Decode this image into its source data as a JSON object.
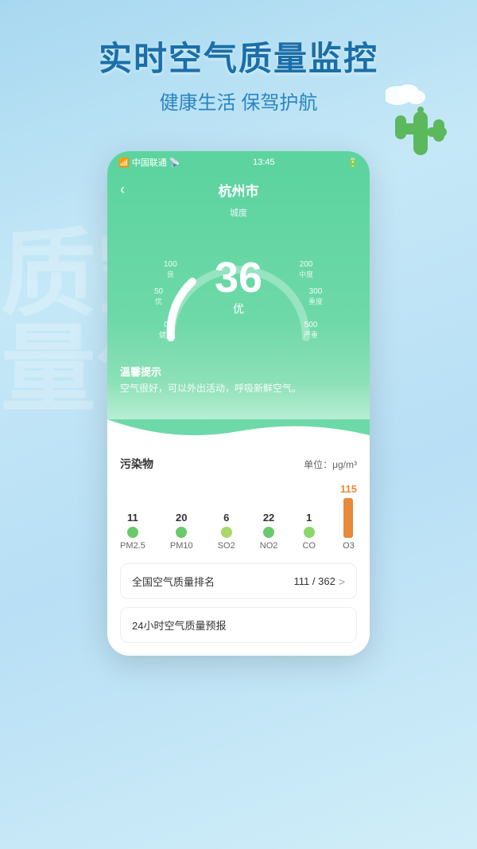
{
  "page": {
    "background": "#a8d8f0",
    "watermark": "空气质量"
  },
  "header": {
    "main_title": "实时空气质量监控",
    "sub_title": "健康生活 保驾护航"
  },
  "status_bar": {
    "carrier": "中国联通",
    "signal": "📶",
    "time": "13:45",
    "battery": "🔋"
  },
  "city_header": {
    "back_label": "‹",
    "city_name": "杭州市",
    "quality_label": "城度"
  },
  "gauge": {
    "aqi_value": "36",
    "quality": "优",
    "labels": [
      {
        "value": "100",
        "sub": "良",
        "angle": "left-upper"
      },
      {
        "value": "200",
        "sub": "中度",
        "angle": "right-upper"
      },
      {
        "value": "50",
        "sub": "优",
        "angle": "left-mid"
      },
      {
        "value": "300",
        "sub": "重度",
        "angle": "right-mid"
      },
      {
        "value": "0",
        "sub": "健康",
        "angle": "left-lower"
      },
      {
        "value": "500",
        "sub": "严重",
        "angle": "right-lower"
      }
    ]
  },
  "tip": {
    "title": "温馨提示",
    "text": "空气很好，可以外出活动，呼吸新鲜空气。"
  },
  "pollutants": {
    "title": "污染物",
    "unit": "单位：μg/m³",
    "items": [
      {
        "name": "PM2.5",
        "value": "11",
        "color": "#6ac96a"
      },
      {
        "name": "PM10",
        "value": "20",
        "color": "#6ac96a"
      },
      {
        "name": "SO2",
        "value": "6",
        "color": "#a8d86a"
      },
      {
        "name": "NO2",
        "value": "22",
        "color": "#6ac96a"
      },
      {
        "name": "CO",
        "value": "1",
        "color": "#8ad86a"
      }
    ],
    "bar_item": {
      "name": "O3",
      "value": "115",
      "color": "#e88a3a"
    }
  },
  "ranking": {
    "label": "全国空气质量排名",
    "value": "111 / 362",
    "arrow": ">"
  },
  "forecast": {
    "label": "24小时空气质量预报"
  }
}
